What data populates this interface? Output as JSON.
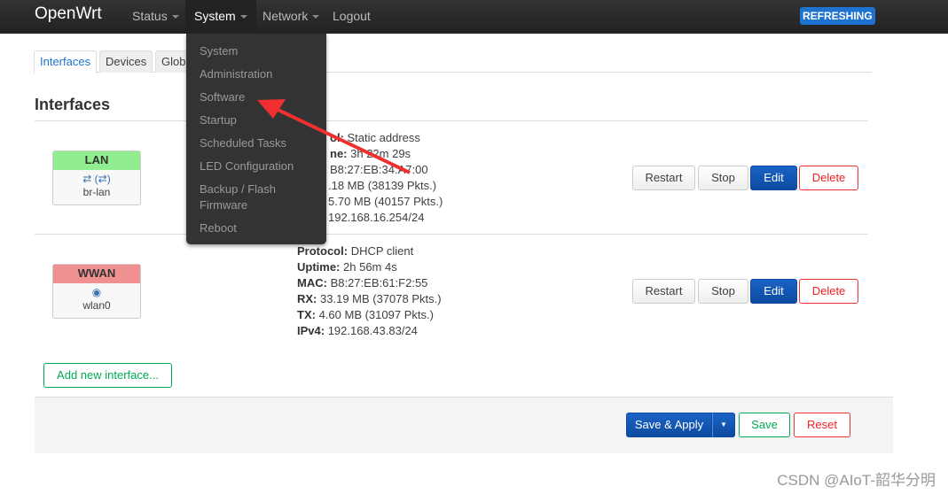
{
  "header": {
    "brand": "OpenWrt",
    "nav": [
      {
        "label": "Status"
      },
      {
        "label": "System"
      },
      {
        "label": "Network"
      },
      {
        "label": "Logout"
      }
    ],
    "badge": "REFRESHING",
    "badge_color": "#1e73d0"
  },
  "tabs": [
    {
      "label": "Interfaces"
    },
    {
      "label": "Devices"
    },
    {
      "label": "Glob"
    }
  ],
  "page_title": "Interfaces",
  "system_menu": [
    "System",
    "Administration",
    "Software",
    "Startup",
    "Scheduled Tasks",
    "LED Configuration",
    "Backup / Flash",
    "Firmware",
    "Reboot"
  ],
  "interfaces": [
    {
      "name": "LAN",
      "color": "#90ee90",
      "icons": "device-icons",
      "device": "br-lan",
      "details": [
        {
          "label": "ol:",
          "value": "Static address"
        },
        {
          "label": "ne:",
          "value": "3h 22m 29s"
        },
        {
          "label": "",
          "value": "B8:27:EB:34:A7:00"
        },
        {
          "label": "",
          "value": ".18 MB (38139 Pkts.)"
        },
        {
          "label": "",
          "value": "5.70 MB (40157 Pkts.)"
        },
        {
          "label": "",
          "value": "192.168.16.254/24"
        }
      ]
    },
    {
      "name": "WWAN",
      "color": "#f09090",
      "icons": "wifi-icon",
      "device": "wlan0",
      "details": [
        {
          "label": "Protocol:",
          "value": "DHCP client"
        },
        {
          "label": "Uptime:",
          "value": "2h 56m 4s"
        },
        {
          "label": "MAC:",
          "value": "B8:27:EB:61:F2:55"
        },
        {
          "label": "RX:",
          "value": "33.19 MB (37078 Pkts.)"
        },
        {
          "label": "TX:",
          "value": "4.60 MB (31097 Pkts.)"
        },
        {
          "label": "IPv4:",
          "value": "192.168.43.83/24"
        }
      ]
    }
  ],
  "row_buttons": {
    "restart": "Restart",
    "stop": "Stop",
    "edit": "Edit",
    "delete": "Delete"
  },
  "add_interface": "Add new interface...",
  "footer": {
    "save_apply": "Save & Apply",
    "save": "Save",
    "reset": "Reset"
  },
  "watermark": "CSDN @AIoT-韶华分明"
}
